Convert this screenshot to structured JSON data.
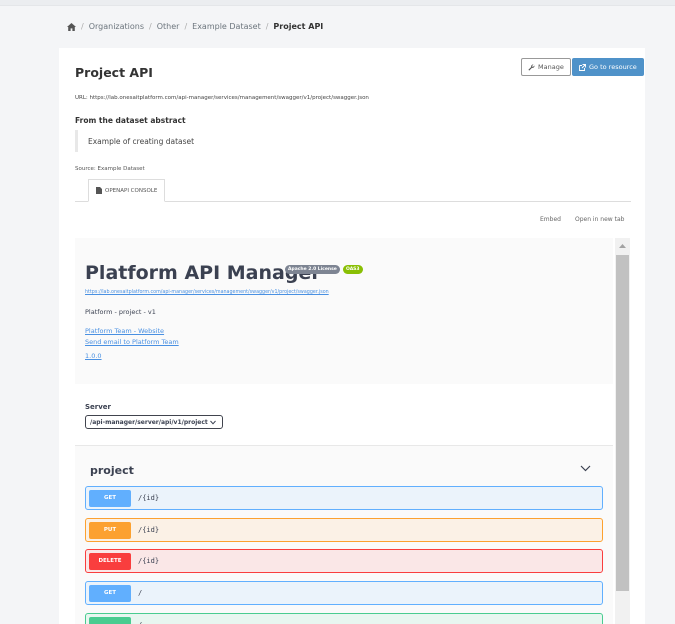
{
  "breadcrumb": {
    "items": [
      "Organizations",
      "Other",
      "Example Dataset"
    ],
    "current": "Project API",
    "separator": "/"
  },
  "resource": {
    "title": "Project API",
    "manage_label": "Manage",
    "go_label": "Go to resource",
    "url_text": "URL: https://lab.onesaitplatform.com/api-manager/services/management/swagger/v1/project/swagger.json",
    "abstract_heading": "From the dataset abstract",
    "abstract_text": "Example of creating dataset",
    "source_text": "Source: Example Dataset",
    "tab_label": "OPENAPI CONSOLE",
    "embed_label": "Embed",
    "new_tab_label": "Open in new tab"
  },
  "swagger": {
    "title": "Platform API Manager",
    "license_badge": "Apache 2.0 License",
    "oas_badge": "OAS3",
    "spec_url": "https://lab.onesaitplatform.com/api-manager/services/management/swagger/v1/project/swagger.json",
    "description": "Platform - project - v1",
    "website_link": "Platform Team - Website",
    "email_link": "Send email to Platform Team",
    "version_link": "1.0.0",
    "server_label": "Server",
    "server_value": "/api-manager/server/api/v1/project",
    "tag": "project",
    "operations": [
      {
        "method": "GET",
        "path": "/{id}"
      },
      {
        "method": "PUT",
        "path": "/{id}"
      },
      {
        "method": "DELETE",
        "path": "/{id}"
      },
      {
        "method": "GET",
        "path": "/"
      },
      {
        "method": "",
        "path": "/"
      }
    ]
  },
  "colors": {
    "get": "#61affe",
    "put": "#fca130",
    "delete": "#f93e3e",
    "post": "#49cc90",
    "primary_button": "#4f92c9",
    "link": "#4990e2"
  },
  "icons": {
    "home": "home-icon",
    "manage": "wrench-icon",
    "go": "external-link-icon",
    "tab": "file-icon",
    "select": "chevron-down-icon",
    "tag": "chevron-down-icon"
  }
}
